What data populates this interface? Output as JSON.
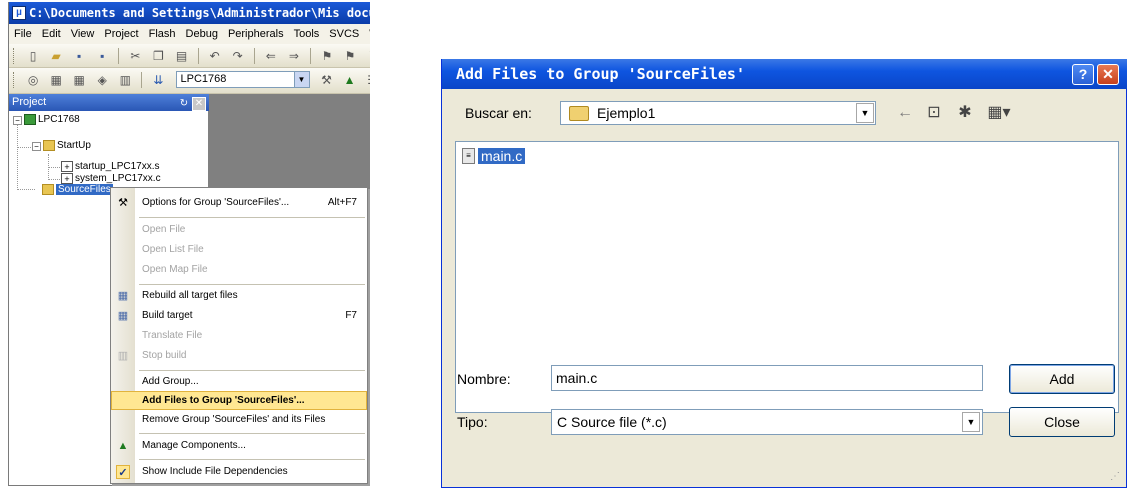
{
  "uvision": {
    "title": "C:\\Documents and Settings\\Administrador\\Mis documentos",
    "menu": [
      "File",
      "Edit",
      "View",
      "Project",
      "Flash",
      "Debug",
      "Peripherals",
      "Tools",
      "SVCS",
      "Wi"
    ],
    "target_select": "LPC1768",
    "project_panel": {
      "title": "Project",
      "tree": {
        "root": "LPC1768",
        "startup_group": "StartUp",
        "startup_files": [
          "startup_LPC17xx.s",
          "system_LPC17xx.c"
        ],
        "selected_group": "SourceFiles"
      }
    },
    "context_menu": {
      "options_item": "Options for Group 'SourceFiles'...",
      "options_shortcut": "Alt+F7",
      "open_file": "Open File",
      "open_list_file": "Open List File",
      "open_map_file": "Open Map File",
      "rebuild_all": "Rebuild all target files",
      "build_target": "Build target",
      "build_target_shortcut": "F7",
      "translate_file": "Translate File",
      "stop_build": "Stop build",
      "add_group": "Add Group...",
      "add_files": "Add Files to Group 'SourceFiles'...",
      "remove_group": "Remove Group 'SourceFiles' and its Files",
      "manage_components": "Manage Components...",
      "show_include": "Show Include File Dependencies"
    }
  },
  "dialog": {
    "title": "Add Files to Group 'SourceFiles'",
    "look_in_label": "Buscar en:",
    "look_in_value": "Ejemplo1",
    "files": [
      "main.c"
    ],
    "name_label": "Nombre:",
    "name_value": "main.c",
    "type_label": "Tipo:",
    "type_value": "C Source file (*.c)",
    "add_button": "Add",
    "close_button": "Close"
  },
  "colors": {
    "title_blue": "#0a45c8",
    "selection_blue": "#316ac5",
    "menu_highlight": "#ffe792",
    "xp_close_red": "#c7401c"
  }
}
